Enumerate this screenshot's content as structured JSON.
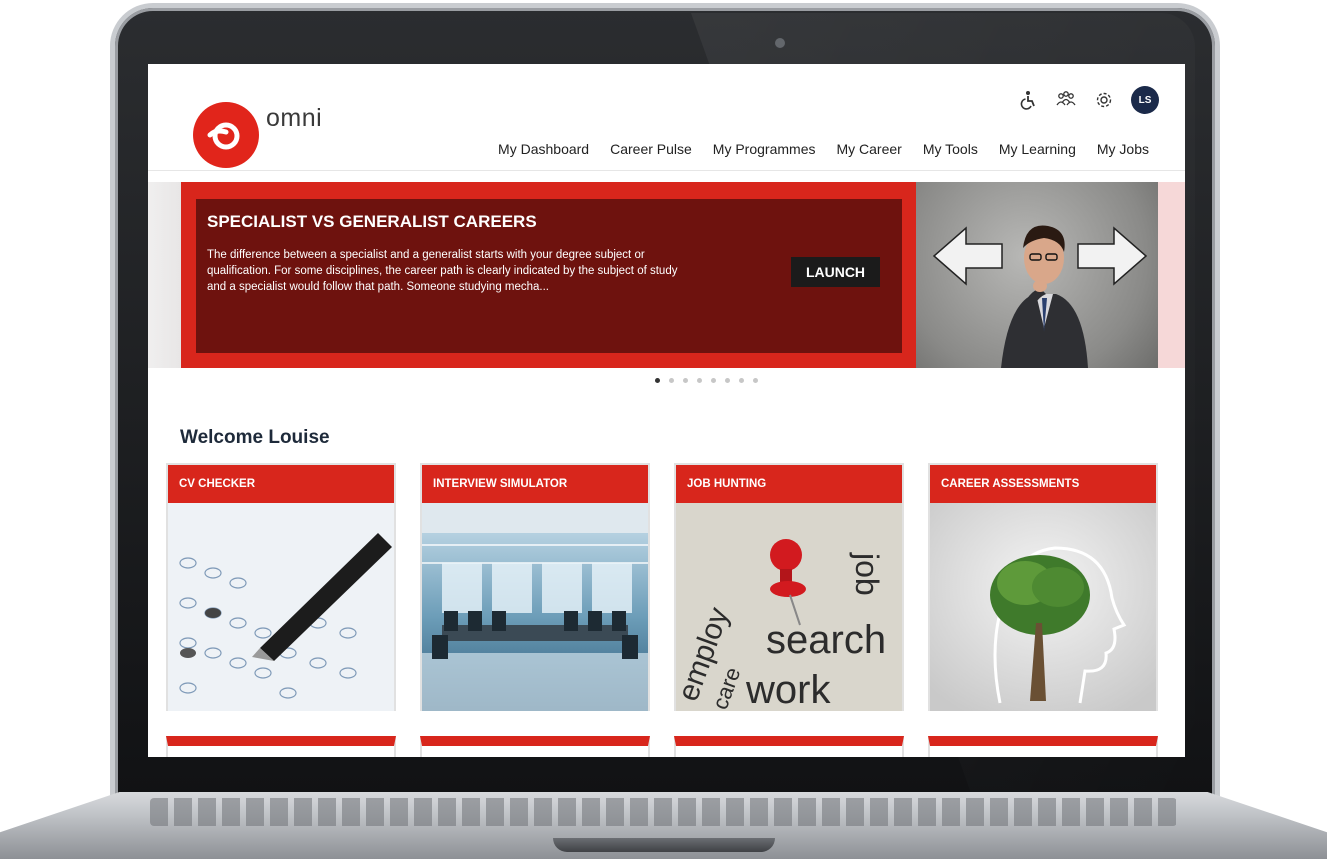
{
  "app": {
    "logo_text": "omni"
  },
  "header": {
    "user_initials": "LS",
    "nav": [
      {
        "label": "My Dashboard"
      },
      {
        "label": "Career Pulse"
      },
      {
        "label": "My Programmes"
      },
      {
        "label": "My Career"
      },
      {
        "label": "My Tools"
      },
      {
        "label": "My Learning"
      },
      {
        "label": "My Jobs"
      }
    ],
    "icons": [
      "accessibility-icon",
      "people-icon",
      "settings-icon"
    ]
  },
  "carousel": {
    "title": "SPECIALIST VS GENERALIST CAREERS",
    "body": "The difference between a specialist and a generalist starts with your degree subject or qualification. For some disciplines, the career path is clearly indicated by the subject of study and a specialist would follow that path. Someone studying mecha...",
    "button_label": "LAUNCH",
    "slide_count": 8,
    "active_slide": 1
  },
  "welcome": {
    "heading": "Welcome Louise"
  },
  "cards": [
    {
      "title": "CV CHECKER"
    },
    {
      "title": "INTERVIEW SIMULATOR"
    },
    {
      "title": "JOB HUNTING"
    },
    {
      "title": "CAREER ASSESSMENTS"
    }
  ],
  "colors": {
    "brand_red": "#d8261c",
    "slide_dark": "#6e120e",
    "avatar_navy": "#1b2a4a"
  }
}
